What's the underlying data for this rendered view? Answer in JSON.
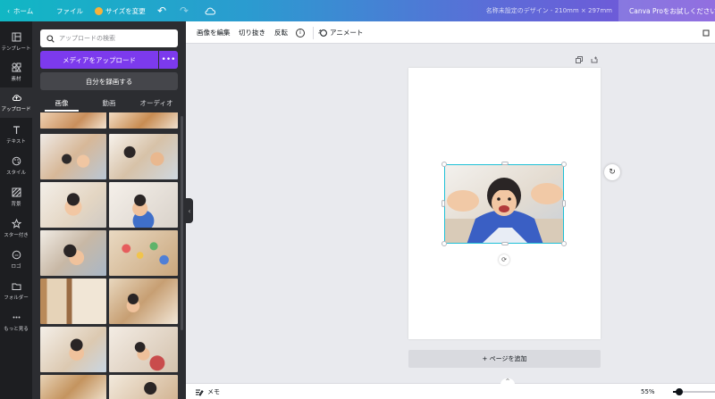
{
  "topbar": {
    "home_label": "ホーム",
    "file_label": "ファイル",
    "resize_label": "サイズを変更",
    "design_title": "名称未設定のデザイン - 210mm × 297mm",
    "pro_label": "Canva Proをお試しください",
    "gradient_start": "#11b7c4",
    "gradient_end": "#7a4fd9"
  },
  "rail": {
    "items": [
      {
        "icon": "template-icon",
        "label": "テンプレート"
      },
      {
        "icon": "elements-icon",
        "label": "素材"
      },
      {
        "icon": "upload-icon",
        "label": "アップロード",
        "active": true
      },
      {
        "icon": "text-icon",
        "label": "テキスト"
      },
      {
        "icon": "palette-icon",
        "label": "スタイル"
      },
      {
        "icon": "background-icon",
        "label": "背景"
      },
      {
        "icon": "star-icon",
        "label": "スター付き"
      },
      {
        "icon": "logo-icon",
        "label": "ロゴ"
      },
      {
        "icon": "folder-icon",
        "label": "フォルダー"
      },
      {
        "icon": "more-dots-icon",
        "label": "もっと見る"
      }
    ]
  },
  "panel": {
    "search_placeholder": "アップロードの検索",
    "upload_label": "メディアをアップロード",
    "upload_more": "•••",
    "record_label": "自分を録画する",
    "tabs": [
      "画像",
      "動画",
      "オーディオ"
    ],
    "active_tab": 0
  },
  "toolbar": {
    "edit_image": "画像を編集",
    "crop": "切り抜き",
    "flip": "反転",
    "info": "i",
    "animate": "アニメート"
  },
  "canvas": {
    "add_page": "+ ページを追加",
    "selection_color": "#1ec0d6"
  },
  "bottombar": {
    "notes_label": "メモ",
    "zoom_label": "55%",
    "zoom_value": 0.55
  },
  "colors": {
    "accent_purple": "#7c3aed",
    "panel_bg": "#2c2d31",
    "rail_bg": "#1d1e21"
  }
}
